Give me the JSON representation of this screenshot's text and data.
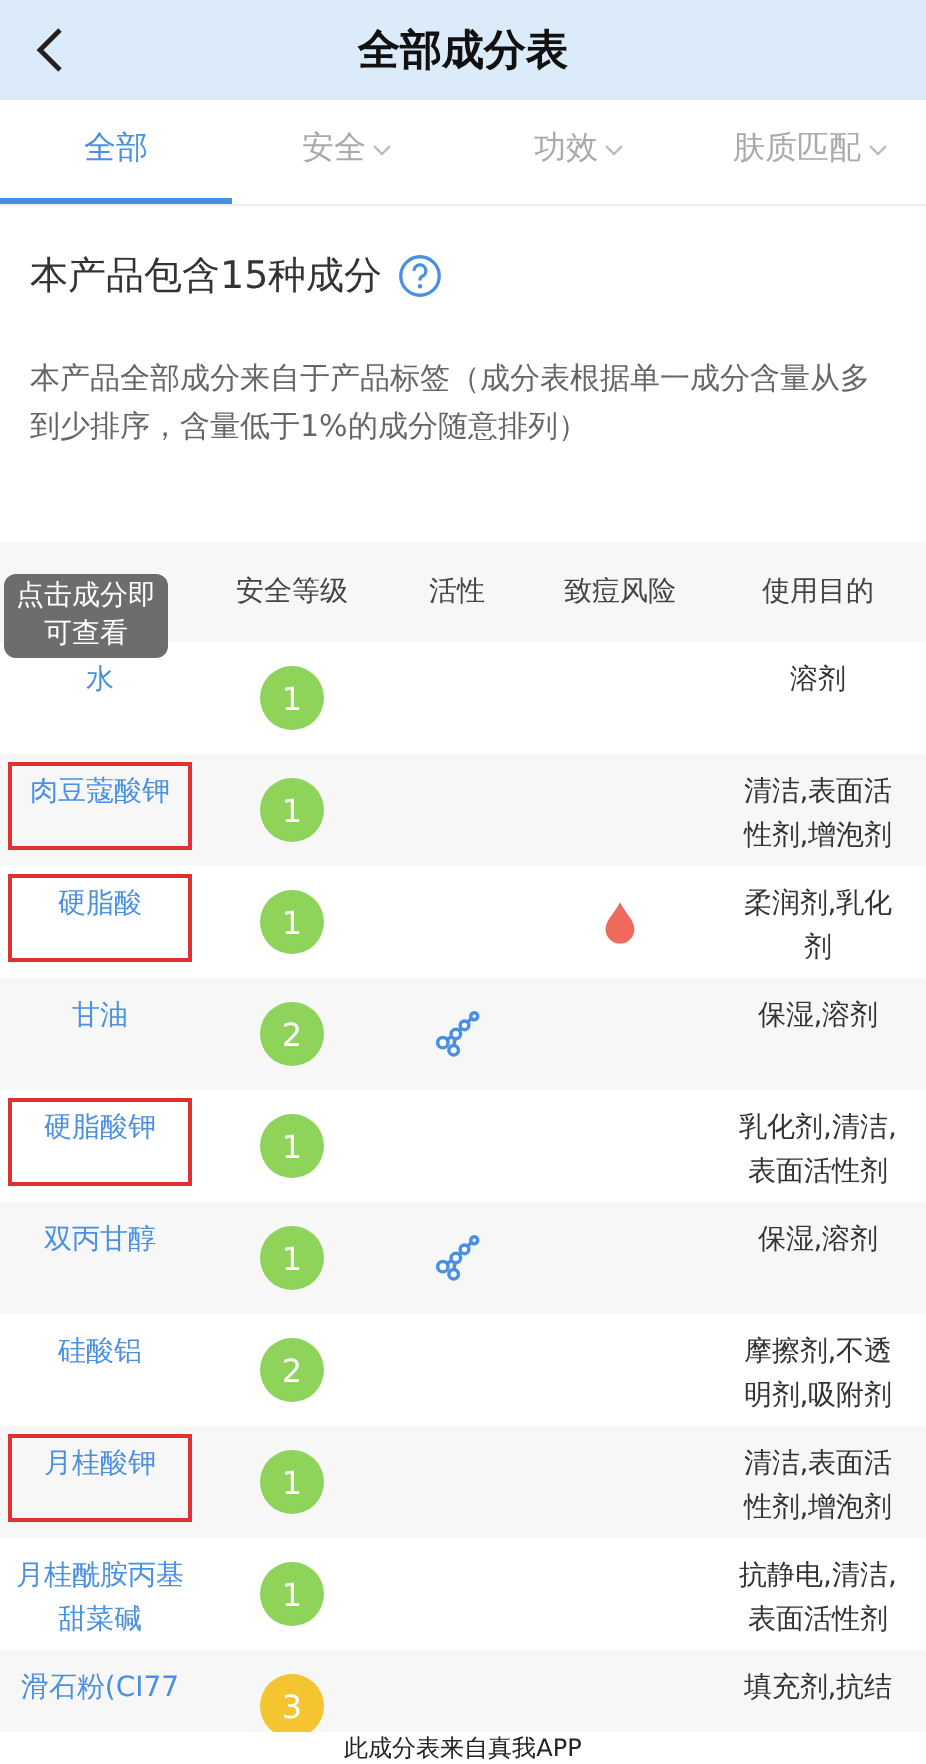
{
  "header": {
    "title": "全部成分表"
  },
  "tabs": [
    {
      "label": "全部",
      "selected": true,
      "dropdown": false
    },
    {
      "label": "安全",
      "selected": false,
      "dropdown": true
    },
    {
      "label": "功效",
      "selected": false,
      "dropdown": true
    },
    {
      "label": "肤质匹配",
      "selected": false,
      "dropdown": true
    }
  ],
  "summary": {
    "title": "本产品包含15种成分",
    "description": "本产品全部成分来自于产品标签（成分表根据单一成分含量从多到少排序，含量低于1%的成分随意排列）"
  },
  "table": {
    "columns": [
      "安全等级",
      "活性",
      "致痘风险",
      "使用目的"
    ],
    "tooltip": "点击成分即可查看",
    "rows": [
      {
        "name": "水",
        "safety": "1",
        "color": "#8ed35a",
        "active": false,
        "acne": false,
        "purpose": "溶剂",
        "highlighted": false
      },
      {
        "name": "肉豆蔻酸钾",
        "safety": "1",
        "color": "#8ed35a",
        "active": false,
        "acne": false,
        "purpose": "清洁,表面活性剂,增泡剂",
        "highlighted": true
      },
      {
        "name": "硬脂酸",
        "safety": "1",
        "color": "#8ed35a",
        "active": false,
        "acne": true,
        "purpose": "柔润剂,乳化剂",
        "highlighted": true
      },
      {
        "name": "甘油",
        "safety": "2",
        "color": "#8ed35a",
        "active": true,
        "acne": false,
        "purpose": "保湿,溶剂",
        "highlighted": false
      },
      {
        "name": "硬脂酸钾",
        "safety": "1",
        "color": "#8ed35a",
        "active": false,
        "acne": false,
        "purpose": "乳化剂,清洁,表面活性剂",
        "highlighted": true
      },
      {
        "name": "双丙甘醇",
        "safety": "1",
        "color": "#8ed35a",
        "active": true,
        "acne": false,
        "purpose": "保湿,溶剂",
        "highlighted": false
      },
      {
        "name": "硅酸铝",
        "safety": "2",
        "color": "#8ed35a",
        "active": false,
        "acne": false,
        "purpose": "摩擦剂,不透明剂,吸附剂",
        "highlighted": false
      },
      {
        "name": "月桂酸钾",
        "safety": "1",
        "color": "#8ed35a",
        "active": false,
        "acne": false,
        "purpose": "清洁,表面活性剂,增泡剂",
        "highlighted": true
      },
      {
        "name": "月桂酰胺丙基甜菜碱",
        "safety": "1",
        "color": "#8ed35a",
        "active": false,
        "acne": false,
        "purpose": "抗静电,清洁,表面活性剂",
        "highlighted": false
      },
      {
        "name": "滑石粉(CI77",
        "safety": "3",
        "color": "#f5c431",
        "active": false,
        "acne": false,
        "purpose": "填充剂,抗结",
        "highlighted": false
      }
    ]
  },
  "footer": "此成分表来自真我APP"
}
